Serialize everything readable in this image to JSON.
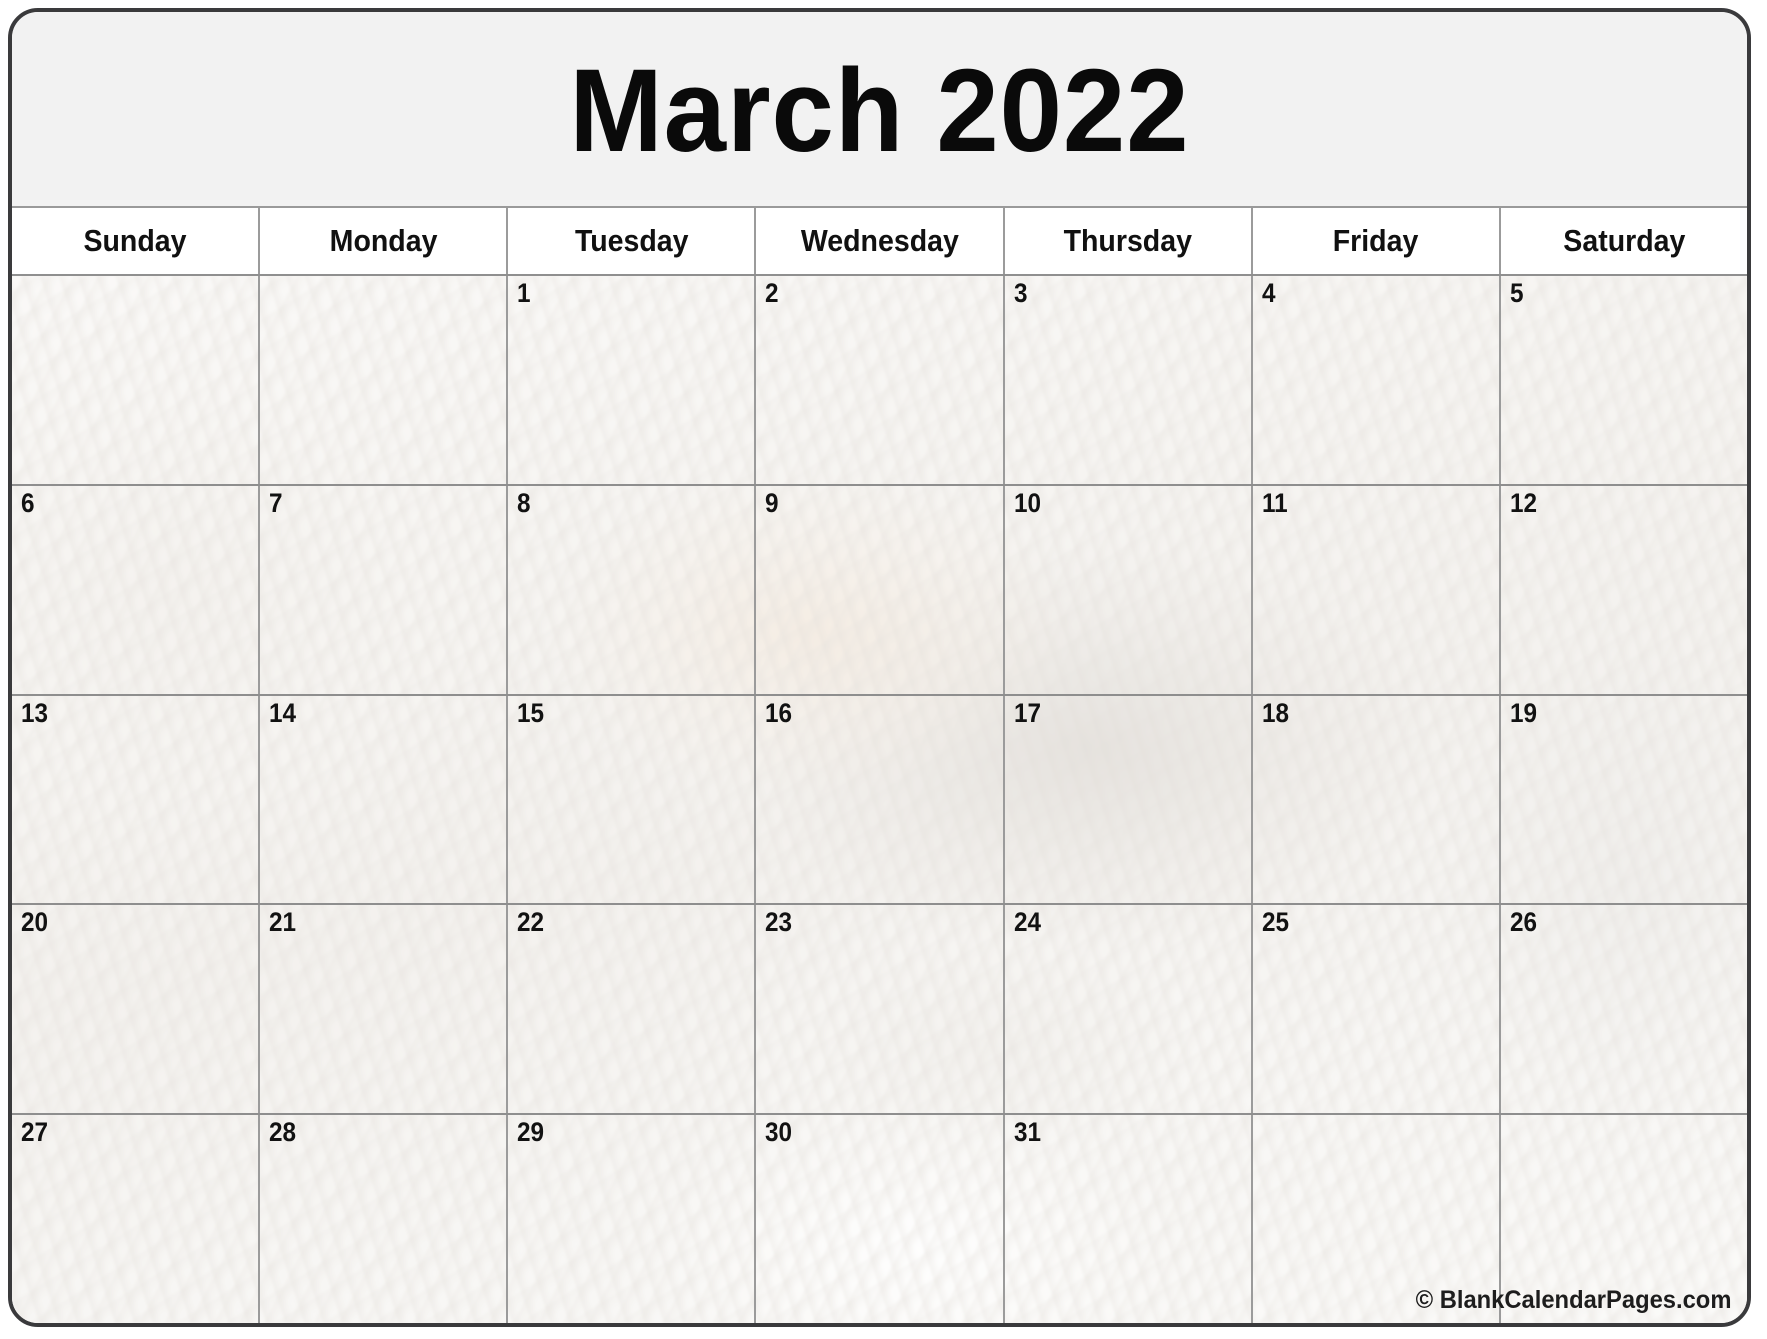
{
  "calendar": {
    "title": "March 2022",
    "month": "March",
    "year": "2022",
    "weekday_headers": [
      "Sunday",
      "Monday",
      "Tuesday",
      "Wednesday",
      "Thursday",
      "Friday",
      "Saturday"
    ],
    "weeks": [
      [
        "",
        "",
        "1",
        "2",
        "3",
        "4",
        "5"
      ],
      [
        "6",
        "7",
        "8",
        "9",
        "10",
        "11",
        "12"
      ],
      [
        "13",
        "14",
        "15",
        "16",
        "17",
        "18",
        "19"
      ],
      [
        "20",
        "21",
        "22",
        "23",
        "24",
        "25",
        "26"
      ],
      [
        "27",
        "28",
        "29",
        "30",
        "31",
        "",
        ""
      ]
    ],
    "credit": "© BlankCalendarPages.com",
    "background_theme": "seashells-photo-faded",
    "colors": {
      "title_band": "#f2f2f2",
      "header_row": "#ffffff",
      "grid_line": "#9b9b9b",
      "outer_border": "#3a3a3c",
      "text": "#111111"
    }
  }
}
